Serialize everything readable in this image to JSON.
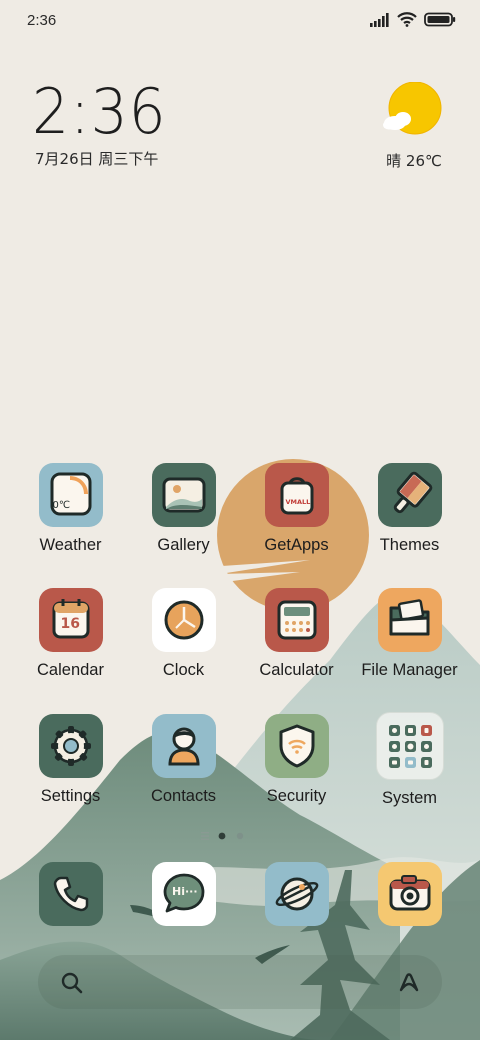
{
  "status_bar": {
    "time": "2:36",
    "icons": [
      "signal-icon",
      "wifi-icon",
      "battery-icon"
    ]
  },
  "clock_widget": {
    "time": "2:36",
    "date": "7月26日 周三下午"
  },
  "weather_widget": {
    "icon": "sun-cloud-icon",
    "text": "晴 26℃"
  },
  "apps": [
    {
      "label": "Weather",
      "icon": "weather-icon"
    },
    {
      "label": "Gallery",
      "icon": "gallery-icon"
    },
    {
      "label": "GetApps",
      "icon": "getapps-icon",
      "icon_text": "VMALL"
    },
    {
      "label": "Themes",
      "icon": "themes-icon"
    },
    {
      "label": "Calendar",
      "icon": "calendar-icon",
      "icon_text": "16"
    },
    {
      "label": "Clock",
      "icon": "clock-icon"
    },
    {
      "label": "Calculator",
      "icon": "calculator-icon"
    },
    {
      "label": "File Manager",
      "icon": "folder-icon"
    },
    {
      "label": "Settings",
      "icon": "gear-icon"
    },
    {
      "label": "Contacts",
      "icon": "contact-icon"
    },
    {
      "label": "Security",
      "icon": "shield-icon"
    },
    {
      "label": "System",
      "icon": "system-folder-icon"
    }
  ],
  "weather_icon_text": "0℃",
  "page_indicator": {
    "pages": 2,
    "current": 1,
    "has_list": true
  },
  "dock": [
    {
      "name": "phone",
      "icon": "phone-icon"
    },
    {
      "name": "messaging",
      "icon": "message-icon",
      "icon_text": "Hi···"
    },
    {
      "name": "browser",
      "icon": "browser-icon"
    },
    {
      "name": "camera",
      "icon": "camera-icon"
    }
  ],
  "search_bar": {
    "left_icon": "search-icon",
    "right_icon": "assistant-icon"
  },
  "colors": {
    "background": "#efebe4",
    "mountain": "#6f8d7d",
    "sun": "#d9a66b",
    "accent_red": "#b9584a"
  }
}
